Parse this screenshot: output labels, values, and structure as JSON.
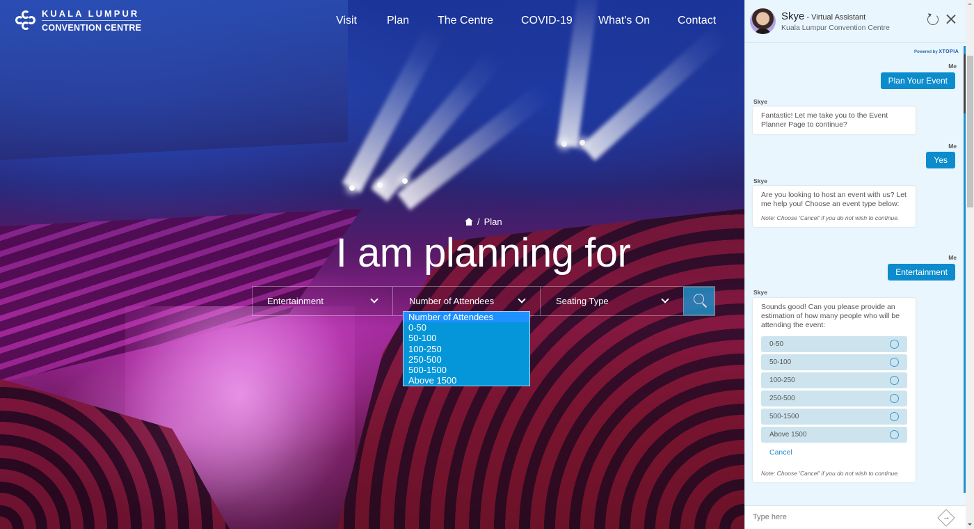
{
  "site": {
    "logo": {
      "line1": "KUALA LUMPUR",
      "line2": "CONVENTION CENTRE"
    },
    "nav": [
      {
        "label": "Visit"
      },
      {
        "label": "Plan"
      },
      {
        "label": "The Centre"
      },
      {
        "label": "COVID-19"
      },
      {
        "label": "What's On"
      },
      {
        "label": "Contact"
      }
    ]
  },
  "hero": {
    "breadcrumb": {
      "home_icon": "home-icon",
      "separator": "/",
      "current": "Plan"
    },
    "headline": "I am planning for",
    "planner": {
      "event_type": {
        "value": "Entertainment"
      },
      "attendees": {
        "value": "Number of Attendees",
        "options": [
          "Number of Attendees",
          "0-50",
          "50-100",
          "100-250",
          "250-500",
          "500-1500",
          "Above 1500"
        ],
        "highlighted": "Number of Attendees"
      },
      "seating": {
        "value": "Seating Type"
      },
      "search_icon": "search-icon"
    }
  },
  "chat": {
    "header": {
      "name": "Skye",
      "role": " - Virtual Assistant",
      "org": "Kuala Lumpur Convention Centre",
      "refresh_icon": "refresh-icon",
      "close_icon": "close-icon"
    },
    "powered": {
      "prefix": "Powered by ",
      "brand": "XTOPIA"
    },
    "messages": [
      {
        "sender": "Me",
        "text": "Plan Your Event"
      },
      {
        "sender": "Skye",
        "text": "Fantastic! Let me take you to the Event Planner Page to continue?"
      },
      {
        "sender": "Me",
        "text": "Yes"
      },
      {
        "sender": "Skye",
        "text": "Are you looking to host an event with us? Let me help you! Choose an event type below:",
        "note": "Note: Choose 'Cancel' if you do not wish to continue."
      },
      {
        "sender": "Me",
        "text": "Entertainment"
      },
      {
        "sender": "Skye",
        "text": "Sounds good! Can you please provide an estimation of how many people who will be attending the event:",
        "choices": [
          "0-50",
          "50-100",
          "100-250",
          "250-500",
          "500-1500",
          "Above 1500"
        ],
        "cancel": "Cancel",
        "note": "Note: Choose 'Cancel' if you do not wish to continue."
      }
    ],
    "input": {
      "placeholder": "Type here",
      "value": ""
    },
    "send_icon": "arrow-right-icon"
  },
  "colors": {
    "accent": "#0c8ccc",
    "dropdown_bg": "#0596d9",
    "dropdown_highlight": "#1e90ff",
    "chat_bg": "#eaf6fd",
    "choice_bg": "#cde4ee"
  }
}
